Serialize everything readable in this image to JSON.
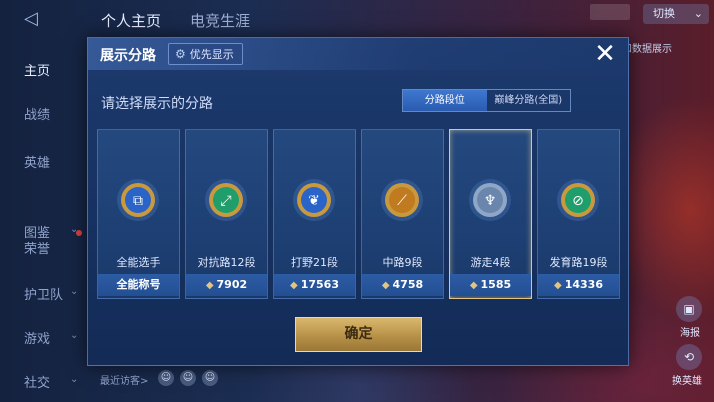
{
  "topbar": {
    "tabs": [
      "个人主页",
      "电竞生涯"
    ],
    "select_label": "切换",
    "sub_text": "式和数据展示"
  },
  "sidebar": {
    "items": [
      {
        "label": "主页"
      },
      {
        "label": "战绩"
      },
      {
        "label": "英雄"
      },
      {
        "label": "图鉴"
      },
      {
        "label": "荣誉"
      },
      {
        "label": "护卫队"
      },
      {
        "label": "游戏"
      },
      {
        "label": "社交"
      }
    ],
    "bottom_text": "最近访客>"
  },
  "right_panel": {
    "labels": [
      "海报",
      "换英雄"
    ]
  },
  "modal": {
    "title": "展示分路",
    "priority_button": "优先显示",
    "close_icon": "close-icon",
    "subtitle": "请选择展示的分路",
    "segments": [
      {
        "label": "分路段位",
        "active": true
      },
      {
        "label": "巅峰分路(全国)",
        "active": false
      }
    ],
    "cards": [
      {
        "name": "全能选手",
        "footer": "全能称号",
        "has_diamond": false,
        "selected": false,
        "ring": "#c99a3d",
        "inner": "#2a64c8",
        "glyph": "⧉"
      },
      {
        "name": "对抗路12段",
        "footer": "7902",
        "has_diamond": true,
        "selected": false,
        "ring": "#c99a3d",
        "inner": "#1f9e6b",
        "glyph": "⤢"
      },
      {
        "name": "打野21段",
        "footer": "17563",
        "has_diamond": true,
        "selected": false,
        "ring": "#c99a3d",
        "inner": "#2a64c8",
        "glyph": "❦"
      },
      {
        "name": "中路9段",
        "footer": "4758",
        "has_diamond": true,
        "selected": false,
        "ring": "#c99a3d",
        "inner": "#c07a20",
        "glyph": "⟋"
      },
      {
        "name": "游走4段",
        "footer": "1585",
        "has_diamond": true,
        "selected": true,
        "ring": "#8fa7c6",
        "inner": "#6a86ad",
        "glyph": "♆"
      },
      {
        "name": "发育路19段",
        "footer": "14336",
        "has_diamond": true,
        "selected": false,
        "ring": "#c99a3d",
        "inner": "#1f9e6b",
        "glyph": "⊘"
      }
    ],
    "confirm_label": "确定"
  }
}
